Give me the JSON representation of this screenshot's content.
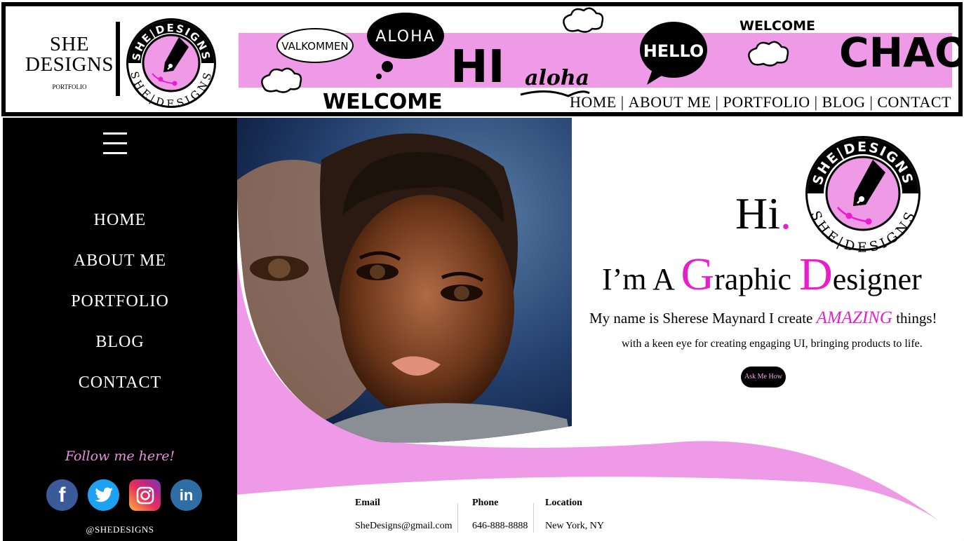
{
  "brand": {
    "title": "SHE\nDESIGNS",
    "subtitle": "PORTFOLIO"
  },
  "logo_text": {
    "top": "SHE|DESIGNS",
    "bottom": "SHE|DESIGNS"
  },
  "banner_words": [
    "VALKOMMEN",
    "ALOHA",
    "HI",
    "aloha",
    "WELCOME",
    "HELLO",
    "WELCOME",
    "CHAO"
  ],
  "top_nav": [
    "HOME",
    "ABOUT ME",
    "PORTFOLIO",
    "BLOG",
    "CONTACT"
  ],
  "top_nav_separator": "|",
  "sidebar": {
    "items": [
      "HOME",
      "ABOUT ME",
      "PORTFOLIO",
      "BLOG",
      "CONTACT"
    ],
    "follow": "Follow me here!",
    "social": [
      {
        "name": "facebook",
        "glyph": "f"
      },
      {
        "name": "twitter",
        "glyph": ""
      },
      {
        "name": "instagram",
        "glyph": ""
      },
      {
        "name": "linkedin",
        "glyph": "in"
      }
    ],
    "handle": "@SHEDESIGNS"
  },
  "hero": {
    "hi": "Hi",
    "hi_dot": ".",
    "headline_prefix": "I’m A ",
    "headline_g": "G",
    "headline_mid": "raphic ",
    "headline_d": "D",
    "headline_end": "esigner",
    "intro_start": "My name is Sherese Maynard I create ",
    "intro_accent": "AMAZING",
    "intro_end": " things!",
    "tagline": "with a keen eye for creating engaging UI, bringing products to life.",
    "cta": "Ask Me How"
  },
  "contact": {
    "email_label": "Email",
    "email": "SheDesigns@gmail.com",
    "phone_label": "Phone",
    "phone": "646-888-8888",
    "location_label": "Location",
    "location": "New York, NY"
  },
  "colors": {
    "accent": "#ea1dcd",
    "pink": "#ef9ae7",
    "black": "#000000"
  }
}
